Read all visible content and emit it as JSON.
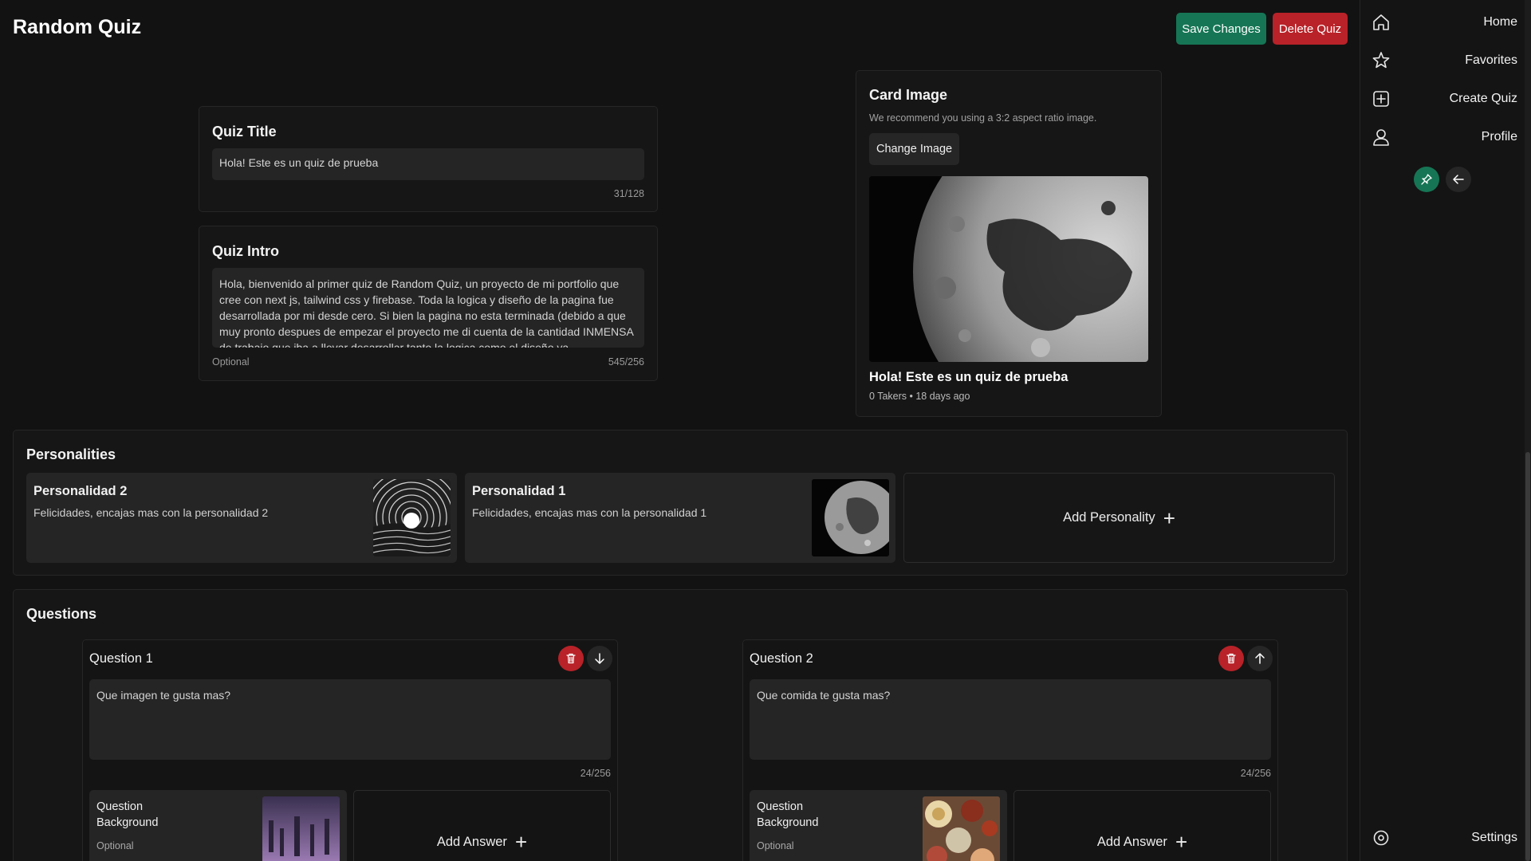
{
  "header": {
    "title": "Random Quiz",
    "save_label": "Save Changes",
    "delete_label": "Delete Quiz"
  },
  "quiz_title": {
    "heading": "Quiz Title",
    "value": "Hola! Este es un quiz de prueba",
    "counter": "31/128"
  },
  "quiz_intro": {
    "heading": "Quiz Intro",
    "value": "Hola, bienvenido al primer quiz de Random Quiz, un proyecto de mi portfolio que cree con next js, tailwind css y firebase. Toda la logica y diseño de la pagina fue desarrollada por mi desde cero. Si bien la pagina no esta terminada (debido a que muy pronto despues de empezar el proyecto me di cuenta de la cantidad INMENSA de trabajo que iba a llevar desarrollar tanto la logica como el diseño ya",
    "optional": "Optional",
    "counter": "545/256"
  },
  "card_image": {
    "heading": "Card Image",
    "hint": "We recommend you using a 3:2 aspect ratio image.",
    "change_label": "Change Image",
    "preview_title": "Hola! Este es un quiz de prueba",
    "preview_meta": "0 Takers • 18 days ago"
  },
  "personalities": {
    "heading": "Personalities",
    "items": [
      {
        "name": "Personalidad 2",
        "description": "Felicidades, encajas mas con la personalidad 2"
      },
      {
        "name": "Personalidad 1",
        "description": "Felicidades, encajas mas con la personalidad 1"
      }
    ],
    "add_label": "Add Personality"
  },
  "questions": {
    "heading": "Questions",
    "items": [
      {
        "label": "Question 1",
        "text": "Que imagen te gusta mas?",
        "counter": "24/256",
        "bg_title": "Question Background",
        "bg_optional": "Optional",
        "add_answer": "Add Answer",
        "move": "down"
      },
      {
        "label": "Question 2",
        "text": "Que comida te gusta mas?",
        "counter": "24/256",
        "bg_title": "Question Background",
        "bg_optional": "Optional",
        "add_answer": "Add Answer",
        "move": "up"
      }
    ]
  },
  "sidebar": {
    "items": [
      {
        "label": "Home",
        "icon": "home-icon"
      },
      {
        "label": "Favorites",
        "icon": "star-icon"
      },
      {
        "label": "Create Quiz",
        "icon": "plus-square-icon"
      },
      {
        "label": "Profile",
        "icon": "user-icon"
      }
    ],
    "settings_label": "Settings"
  },
  "colors": {
    "background": "#121212",
    "save": "#167555",
    "delete": "#b82228",
    "field": "#252525"
  }
}
